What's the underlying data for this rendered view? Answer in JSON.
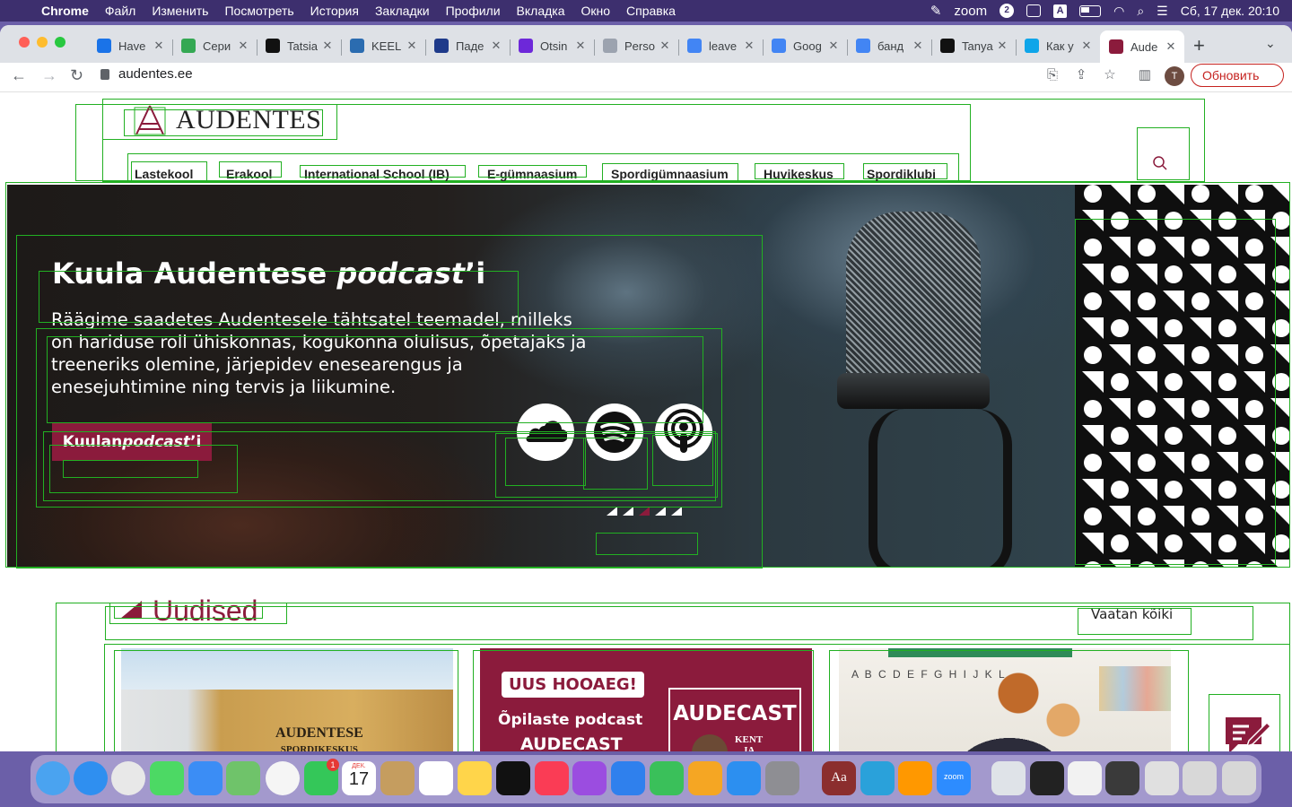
{
  "menubar": {
    "app": "Chrome",
    "items": [
      "Файл",
      "Изменить",
      "Посмотреть",
      "История",
      "Закладки",
      "Профили",
      "Вкладка",
      "Окно",
      "Справка"
    ],
    "zoom_label": "zoom",
    "zoom_badge": "2",
    "datetime": "Сб, 17 дек.  20:10"
  },
  "tabs": [
    {
      "title": "Have",
      "fav_color": "#1a73e8"
    },
    {
      "title": "Сери",
      "fav_color": "#34a853"
    },
    {
      "title": "Tatsia",
      "fav_color": "#111111"
    },
    {
      "title": "KEEL",
      "fav_color": "#2b6cb0"
    },
    {
      "title": "Паде",
      "fav_color": "#1e3a8a"
    },
    {
      "title": "Otsin",
      "fav_color": "#6d28d9"
    },
    {
      "title": "Perso",
      "fav_color": "#9ca3af"
    },
    {
      "title": "leave",
      "fav_color": "#4285f4"
    },
    {
      "title": "Goog",
      "fav_color": "#4285f4"
    },
    {
      "title": "банд",
      "fav_color": "#4285f4"
    },
    {
      "title": "Tanya",
      "fav_color": "#111111"
    },
    {
      "title": "Как у",
      "fav_color": "#0ea5e9"
    },
    {
      "title": "Aude",
      "fav_color": "#8b1b3c"
    }
  ],
  "toolbar": {
    "url": "audentes.ee",
    "avatar_letter": "T",
    "update_label": "Обновить"
  },
  "site": {
    "logo_text": "AUDENTES",
    "nav": [
      "Lastekool",
      "Erakool",
      "International School (IB)",
      "E-gümnaasium",
      "Spordigümnaasium",
      "Huvikeskus",
      "Spordiklubi"
    ],
    "hero": {
      "title_plain": "Kuula Audentese ",
      "title_italic": "podcast",
      "title_suffix": "’i",
      "text": "Räägime saadetes Audentesele tähtsatel teemadel, milleks on hariduse roll ühiskonnas, kogukonna olulisus, õpetajaks ja treeneriks olemine, järjepidev enesearengus ja enesejuhtimine ning tervis ja liikumine.",
      "button_plain": "Kuulan ",
      "button_italic": "podcast",
      "button_suffix": "’i",
      "slides_count": 5,
      "active_slide": 3
    },
    "news": {
      "title": "Uudised",
      "see_all": "Vaatan kõiki",
      "card1_sign_line1": "AUDENTESE",
      "card1_sign_line2": "SPORDIKESKUS",
      "card2_badge": "UUS HOOAEG!",
      "card2_line1": "Õpilaste podcast",
      "card2_line2": "AUDECAST",
      "card2_logo": "AUDECAST",
      "card2_sub": "KENT\nJA\nRHET",
      "card3_letters": "A B C D E F G H I J K L"
    }
  },
  "dock": {
    "calendar_month": "ДЕК.",
    "calendar_day": "17",
    "facetime_badge": "1",
    "dict_label": "Aa",
    "zoom_label": "zoom"
  },
  "colors": {
    "brand": "#8b1b3c",
    "outline": "#22b022"
  }
}
